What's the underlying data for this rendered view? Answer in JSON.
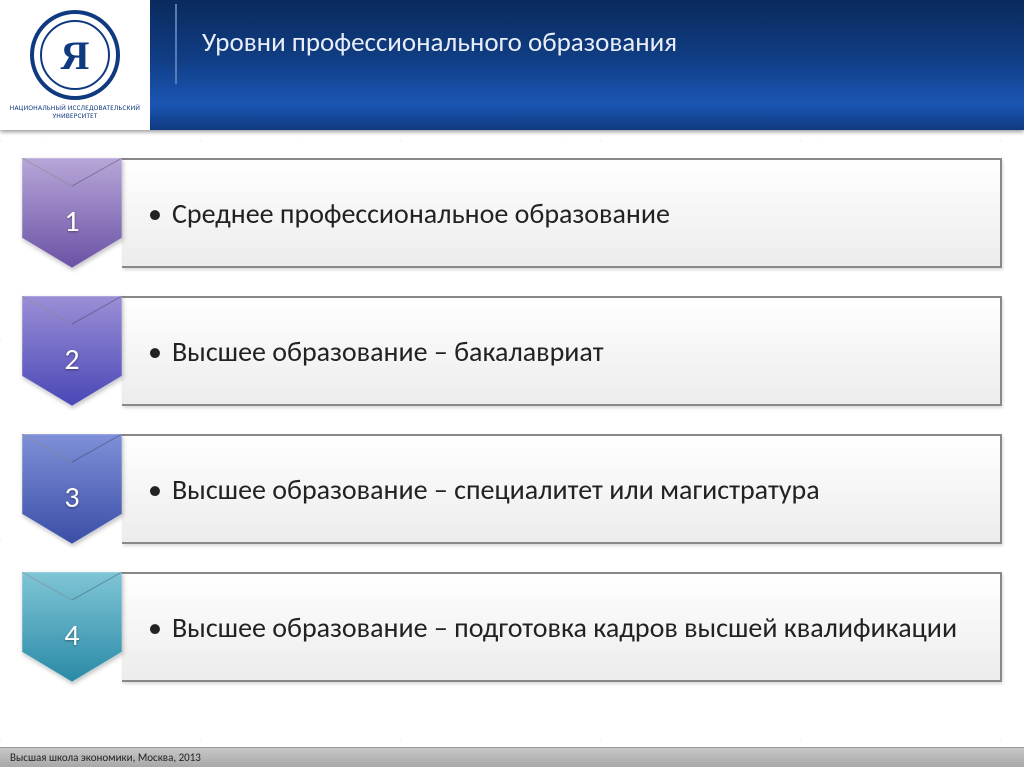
{
  "header": {
    "logo_letter": "Я",
    "logo_sub_line1": "НАЦИОНАЛЬНЫЙ ИССЛЕДОВАТЕЛЬСКИЙ",
    "logo_sub_line2": "УНИВЕРСИТЕТ",
    "title": "Уровни профессионального образования"
  },
  "items": [
    {
      "num": "1",
      "text": "Среднее профессиональное образование",
      "grad_top": "#b7a6d8",
      "grad_bot": "#6a52a5"
    },
    {
      "num": "2",
      "text": "Высшее образование – бакалавриат",
      "grad_top": "#9a8fd6",
      "grad_bot": "#4a47b6"
    },
    {
      "num": "3",
      "text": "Высшее образование – специалитет или магистратура",
      "grad_top": "#7f90d8",
      "grad_bot": "#3a4ea6"
    },
    {
      "num": "4",
      "text": "Высшее образование – подготовка кадров высшей квалификации",
      "grad_top": "#7fc5d6",
      "grad_bot": "#2a8aa6"
    }
  ],
  "footer": {
    "text": "Высшая школа экономики, Москва, 2013"
  }
}
